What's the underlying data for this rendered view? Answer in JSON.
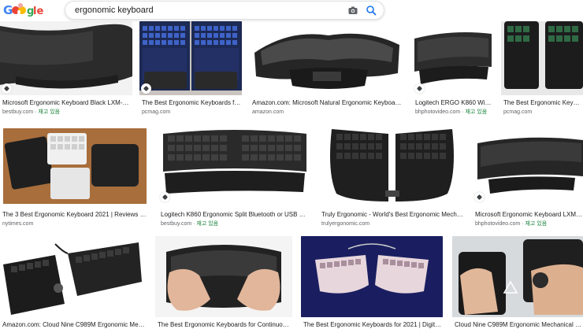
{
  "search": {
    "query": "ergonomic keyboard"
  },
  "header": {
    "logo_icon": "google-doodle-logo",
    "camera_icon": "camera-icon",
    "search_icon": "search-icon"
  },
  "colors": {
    "accent": "#1a73e8",
    "in_stock": "#188038"
  },
  "results": [
    {
      "caption": "Microsoft Ergonomic Keyboard Black LXM-0000…",
      "source": "bestbuy.com",
      "stock": "재고 있음"
    },
    {
      "caption": "The Best Ergonomic Keyboards for 2…",
      "source": "pcmag.com",
      "stock": ""
    },
    {
      "caption": "Amazon.com: Microsoft Natural Ergonomic Keyboard 400…",
      "source": "amazon.com",
      "stock": ""
    },
    {
      "caption": "Logitech ERGO K860 Wirele…",
      "source": "bhphotovideo.com",
      "stock": "재고 있음"
    },
    {
      "caption": "The Best Ergonomic Keyboards",
      "source": "pcmag.com",
      "stock": ""
    },
    {
      "caption": "The 3 Best Ergonomic Keyboard 2021 | Reviews by Wire…",
      "source": "nytimes.com",
      "stock": ""
    },
    {
      "caption": "Logitech K860 Ergonomic Split Bluetooth or USB …",
      "source": "bestbuy.com",
      "stock": "재고 있음"
    },
    {
      "caption": "Truly Ergonomic - World's Best Ergonomic Mechanical…",
      "source": "trulyergonomic.com",
      "stock": ""
    },
    {
      "caption": "Microsoft Ergonomic Keyboard LXM-000…",
      "source": "bhphotovideo.com",
      "stock": "재고 있음"
    },
    {
      "caption": "Amazon.com: Cloud Nine C989M Ergonomic Mechanic…",
      "source": "",
      "stock": ""
    },
    {
      "caption": "The Best Ergonomic Keyboards for Continuous C…",
      "source": "",
      "stock": ""
    },
    {
      "caption": "The Best Ergonomic Keyboards for 2021 | Digital Tre…",
      "source": "",
      "stock": ""
    },
    {
      "caption": "Cloud Nine C989M Ergonomic Mechanical Keyb…",
      "source": "",
      "stock": ""
    }
  ]
}
